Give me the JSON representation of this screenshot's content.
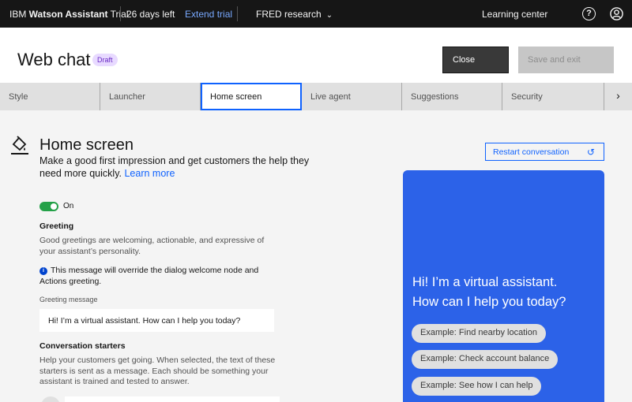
{
  "topbar": {
    "product_prefix": "IBM ",
    "product_name": "Watson Assistant",
    "plan": "Trial",
    "days_left": "26 days left",
    "extend": "Extend trial",
    "instance": "FRED research",
    "learning": "Learning center",
    "help_glyph": "?"
  },
  "header": {
    "title": "Web chat",
    "badge": "Draft",
    "close_label": "Close",
    "save_label": "Save and exit"
  },
  "tabs": [
    {
      "label": "Style"
    },
    {
      "label": "Launcher"
    },
    {
      "label": "Home screen"
    },
    {
      "label": "Live agent"
    },
    {
      "label": "Suggestions"
    },
    {
      "label": "Security"
    }
  ],
  "main": {
    "title": "Home screen",
    "description": "Make a good first impression and get customers the help they need more quickly.",
    "learn_more": "Learn more",
    "toggle_label": "On",
    "greeting_heading": "Greeting",
    "greeting_helper": "Good greetings are welcoming, actionable, and expressive of your assistant’s personality.",
    "info_note": "This message will override the dialog welcome node and Actions greeting.",
    "greeting_field_label": "Greeting message",
    "greeting_value": "Hi! I’m a virtual assistant. How can I help you today?",
    "starters_heading": "Conversation starters",
    "starters_helper": "Help your customers get going. When selected, the text of these starters is sent as a message. Each should be something your assistant is trained and tested to answer."
  },
  "preview": {
    "restart_label": "Restart conversation",
    "greeting_line1": "Hi! I’m a virtual assistant.",
    "greeting_line2": "How can I help you today?",
    "chips": [
      "Example: Find nearby location",
      "Example: Check account balance",
      "Example: See how I can help"
    ],
    "bg_color": "#2c62e8"
  },
  "colors": {
    "accent": "#0f62fe",
    "toggle_on": "#24a148",
    "badge_bg": "#e8daff"
  }
}
